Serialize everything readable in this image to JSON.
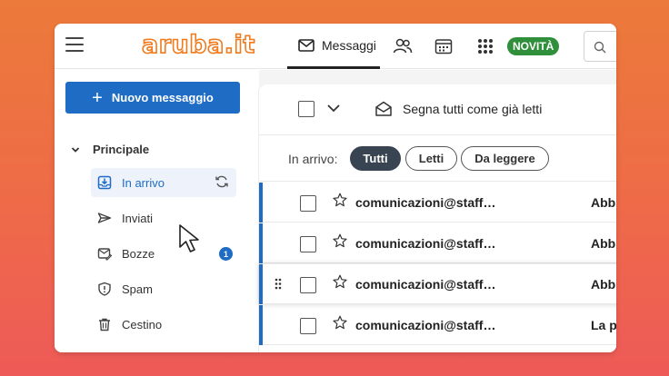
{
  "header": {
    "logo_text": "aruba.it",
    "nav": {
      "messages_label": "Messaggi"
    },
    "badge": "NOVITÀ"
  },
  "sidebar": {
    "compose_label": "Nuovo messaggio",
    "section_label": "Principale",
    "folders": [
      {
        "label": "In arrivo",
        "icon": "inbox-icon",
        "active": true
      },
      {
        "label": "Inviati",
        "icon": "send-icon"
      },
      {
        "label": "Bozze",
        "icon": "drafts-icon",
        "count": "1"
      },
      {
        "label": "Spam",
        "icon": "spam-icon"
      },
      {
        "label": "Cestino",
        "icon": "trash-icon"
      }
    ]
  },
  "toolbar": {
    "mark_all_read_label": "Segna tutti come già letti"
  },
  "filters": {
    "label": "In arrivo:",
    "chips": [
      {
        "label": "Tutti",
        "active": true
      },
      {
        "label": "Letti"
      },
      {
        "label": "Da leggere"
      }
    ]
  },
  "messages": [
    {
      "sender": "comunicazioni@staff…",
      "subject": "Abb"
    },
    {
      "sender": "comunicazioni@staff…",
      "subject": "Abb"
    },
    {
      "sender": "comunicazioni@staff…",
      "subject": "Abb"
    },
    {
      "sender": "comunicazioni@staff…",
      "subject": "La p"
    }
  ],
  "colors": {
    "accent": "#1e6cc4",
    "brand_orange": "#ef7b1e",
    "novita_green": "#2f8f3a"
  }
}
